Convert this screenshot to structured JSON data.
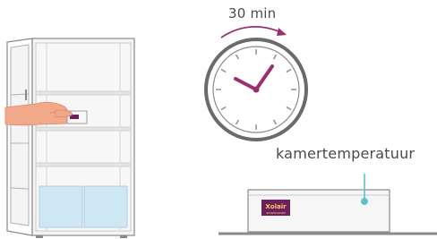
{
  "timer": {
    "duration": "30 min"
  },
  "ambient": {
    "label": "kamertemperatuur"
  },
  "product": {
    "brand": "Xolair",
    "sub": "omalizumab"
  },
  "colors": {
    "accent": "#9b2f6e",
    "outline": "#8a8a8a",
    "fridge_fill": "#f4f4f4",
    "fridge_shelf": "#e4e4e4",
    "drawer": "#cfe6f4",
    "skin": "#f2a98a",
    "indicator": "#5bc4c9",
    "product_box": "#f6f6f6",
    "brand_bg": "#6e1f5c"
  },
  "icons": [
    "refrigerator-icon",
    "hand-icon",
    "clock-icon",
    "arrow-icon",
    "product-box-icon"
  ]
}
